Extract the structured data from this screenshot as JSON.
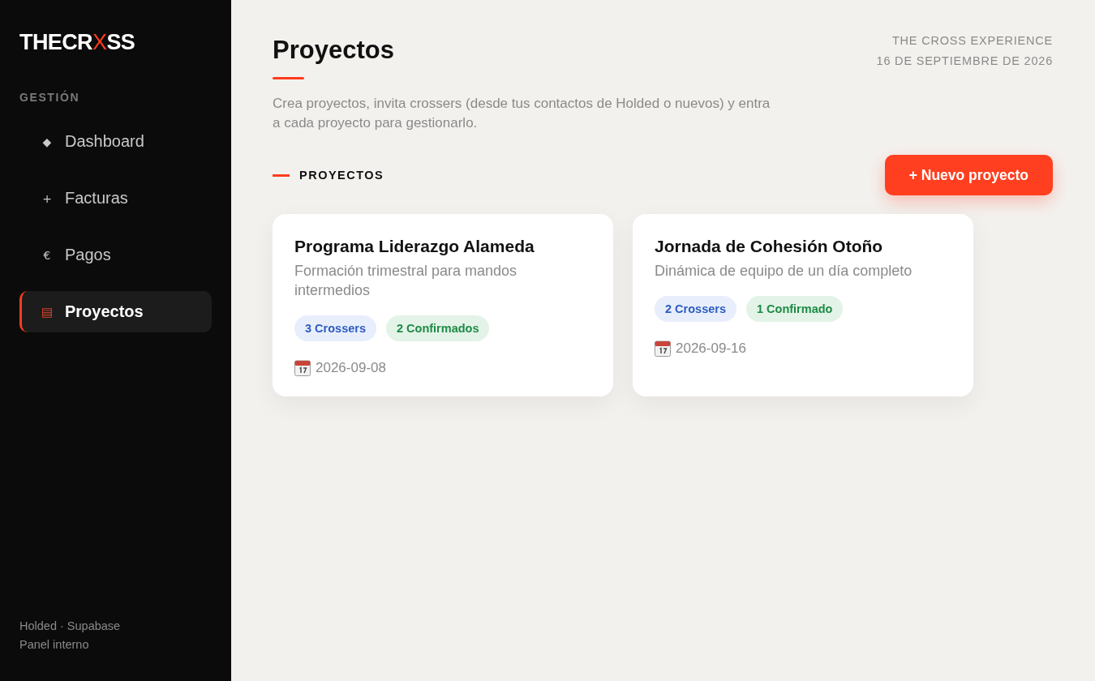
{
  "sidebar": {
    "logo": {
      "parts": [
        {
          "text": "THECR",
          "accent": false
        },
        {
          "text": "X",
          "accent": true
        },
        {
          "text": "SS",
          "accent": false
        }
      ]
    },
    "section_label": "GESTIÓN",
    "items": [
      {
        "icon": "◆",
        "label": "Dashboard",
        "selected": false
      },
      {
        "icon": "+",
        "label": "Facturas",
        "selected": false
      },
      {
        "icon": "€",
        "label": "Pagos",
        "selected": false
      },
      {
        "icon": "▤",
        "label": "Proyectos",
        "selected": true
      }
    ],
    "footer": [
      "Holded · Supabase",
      "Panel interno"
    ]
  },
  "header": {
    "title": "Proyectos",
    "description": "Crea proyectos, invita crossers (desde tus contactos de Holded o nuevos) y entra a cada proyecto para gestionarlo.",
    "org": "THE CROSS EXPERIENCE",
    "date": "16 DE SEPTIEMBRE DE 2026"
  },
  "section": {
    "title": "PROYECTOS",
    "button": "+ Nuevo proyecto"
  },
  "projects": [
    {
      "title": "Programa Liderazgo Alameda",
      "subtitle": "Formación trimestral para mandos intermedios",
      "badges": [
        {
          "kind": "crossers",
          "text": "3 Crossers"
        },
        {
          "kind": "confirmed",
          "text": "2 Confirmados"
        }
      ],
      "date": "2026-09-08"
    },
    {
      "title": "Jornada de Cohesión Otoño",
      "subtitle": "Dinámica de equipo de un día completo",
      "badges": [
        {
          "kind": "crossers",
          "text": "2 Crossers"
        },
        {
          "kind": "confirmed",
          "text": "1 Confirmado"
        }
      ],
      "date": "2026-09-16"
    }
  ]
}
